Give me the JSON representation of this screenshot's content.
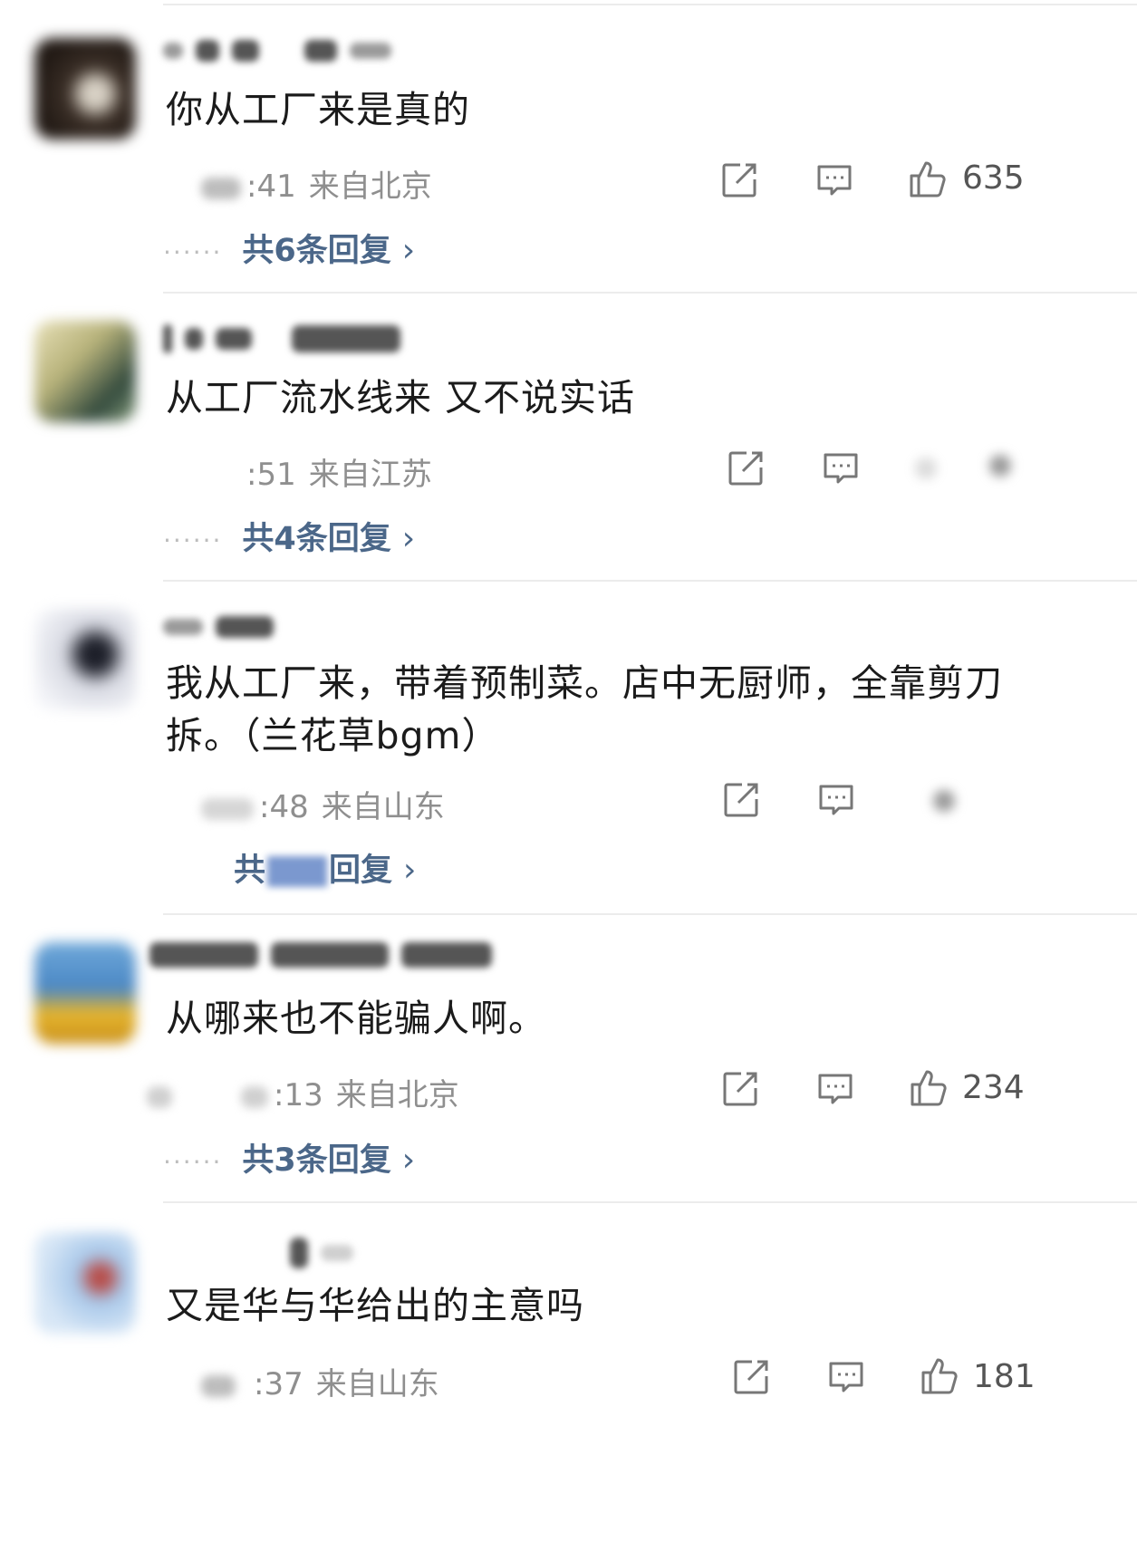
{
  "comments": [
    {
      "text": "你从工厂来是真的",
      "time_suffix": ":41",
      "location": "来自北京",
      "likes": "635",
      "replies_label": "共6条回复",
      "replies_prefix": "共",
      "replies_suffix": "条回复",
      "chevron": "›",
      "dots": "······"
    },
    {
      "text": "从工厂流水线来 又不说实话",
      "time_suffix": ":51",
      "location": "来自江苏",
      "likes": "",
      "replies_label": "共4条回复",
      "chevron": "›",
      "dots": "······"
    },
    {
      "text_line1": "我从工厂来，带着预制菜。店中无厨师，全靠剪刀",
      "text_line2": "拆。（兰花草bgm）",
      "time_suffix": ":48",
      "location": "来自山东",
      "likes": "",
      "replies_prefix": "共",
      "replies_suffix": "回复",
      "chevron": "›"
    },
    {
      "text": "从哪来也不能骗人啊。",
      "time_suffix": ":13",
      "location": "来自北京",
      "likes": "234",
      "replies_label": "共3条回复",
      "chevron": "›",
      "dots": "······"
    },
    {
      "text": "又是华与华给出的主意吗",
      "time_suffix": ":37",
      "location": "来自山东",
      "likes": "181"
    }
  ],
  "icons": {
    "share": "share-icon",
    "comment": "comment-icon",
    "like": "thumbs-up-icon"
  }
}
